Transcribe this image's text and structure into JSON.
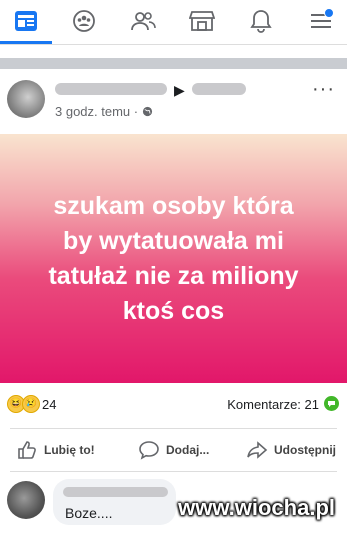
{
  "nav": {
    "active_color": "#1877f2"
  },
  "post": {
    "timestamp": "3 godz. temu",
    "separator": "·",
    "more": "···",
    "text_lines": [
      "szukam osoby która",
      "by wytatuowała mi",
      "tatułaż nie za miliony",
      "ktoś cos"
    ],
    "reactions_count": "24",
    "comments_count": "Komentarze: 21",
    "actions": {
      "like": "Lubię to!",
      "comment": "Dodaj...",
      "share": "Udostępnij"
    }
  },
  "comment": {
    "text": "Boze...."
  },
  "watermark": "www.wiocha.pl"
}
